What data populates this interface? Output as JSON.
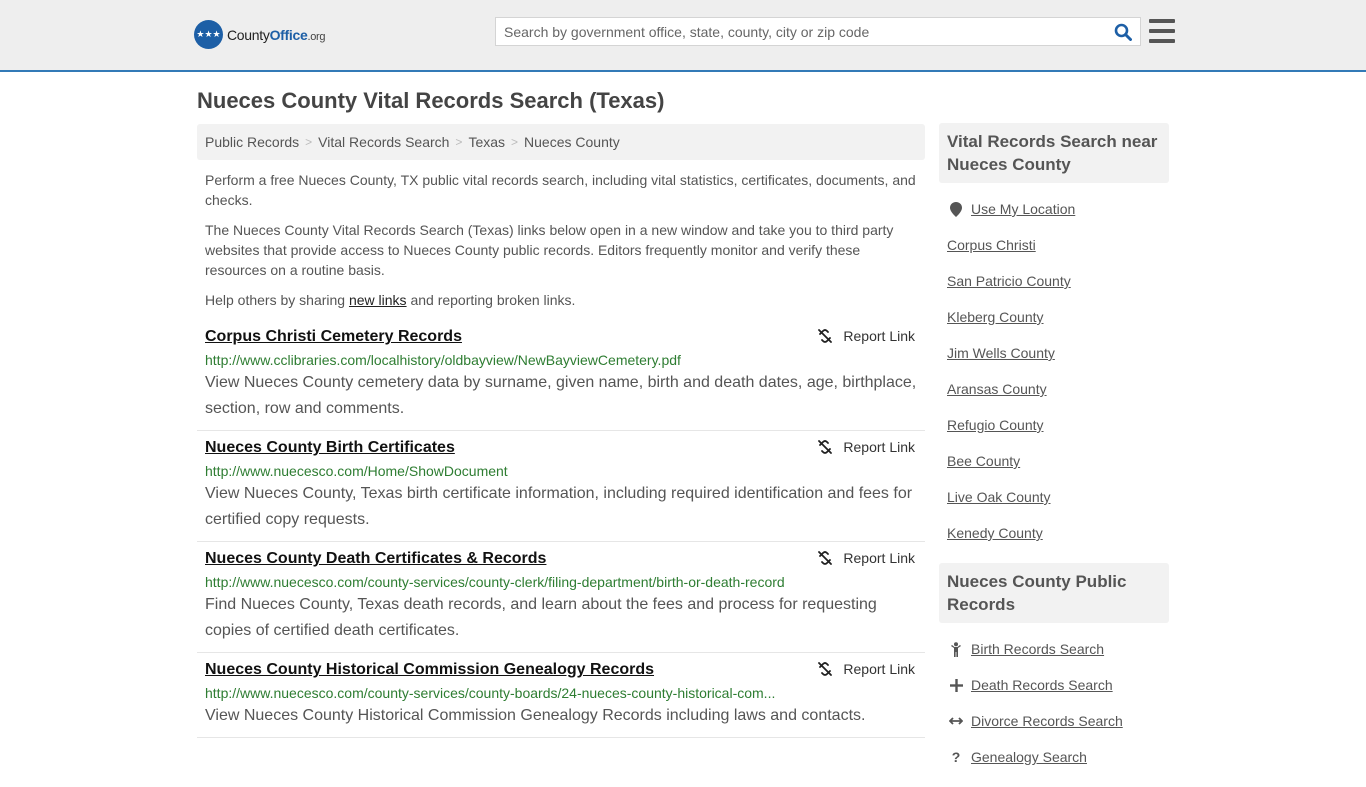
{
  "header": {
    "logo": {
      "prefix": "County",
      "brand": "Office",
      "suffix": ".org"
    },
    "search_placeholder": "Search by government office, state, county, city or zip code",
    "search_icon": "search-icon",
    "menu_icon": "hamburger-menu-icon",
    "accent_color": "#337ab7"
  },
  "page_title": "Nueces County Vital Records Search (Texas)",
  "breadcrumb": [
    "Public Records",
    "Vital Records Search",
    "Texas",
    "Nueces County"
  ],
  "intro": {
    "p1": "Perform a free Nueces County, TX public vital records search, including vital statistics, certificates, documents, and checks.",
    "p2": "The Nueces County Vital Records Search (Texas) links below open in a new window and take you to third party websites that provide access to Nueces County public records. Editors frequently monitor and verify these resources on a routine basis.",
    "p3_before": "Help others by sharing ",
    "p3_link": "new links",
    "p3_after": " and reporting broken links."
  },
  "report_label": "Report Link",
  "results": [
    {
      "title": "Corpus Christi Cemetery Records",
      "url": "http://www.cclibraries.com/localhistory/oldbayview/NewBayviewCemetery.pdf",
      "description": "View Nueces County cemetery data by surname, given name, birth and death dates, age, birthplace, section, row and comments."
    },
    {
      "title": "Nueces County Birth Certificates",
      "url": "http://www.nuecesco.com/Home/ShowDocument",
      "description": "View Nueces County, Texas birth certificate information, including required identification and fees for certified copy requests."
    },
    {
      "title": "Nueces County Death Certificates & Records",
      "url": "http://www.nuecesco.com/county-services/county-clerk/filing-department/birth-or-death-record",
      "description": "Find Nueces County, Texas death records, and learn about the fees and process for requesting copies of certified death certificates."
    },
    {
      "title": "Nueces County Historical Commission Genealogy Records",
      "url": "http://www.nuecesco.com/county-services/county-boards/24-nueces-county-historical-com...",
      "description": "View Nueces County Historical Commission Genealogy Records including laws and contacts."
    }
  ],
  "sidebar": {
    "nearby": {
      "heading": "Vital Records Search near Nueces County",
      "use_location": "Use My Location",
      "items": [
        "Corpus Christi",
        "San Patricio County",
        "Kleberg County",
        "Jim Wells County",
        "Aransas County",
        "Refugio County",
        "Bee County",
        "Live Oak County",
        "Kenedy County"
      ]
    },
    "public_records": {
      "heading": "Nueces County Public Records",
      "items": [
        {
          "label": "Birth Records Search",
          "icon": "child-icon"
        },
        {
          "label": "Death Records Search",
          "icon": "cross-icon"
        },
        {
          "label": "Divorce Records Search",
          "icon": "arrows-horizontal-icon"
        },
        {
          "label": "Genealogy Search",
          "icon": "question-icon"
        }
      ]
    }
  }
}
